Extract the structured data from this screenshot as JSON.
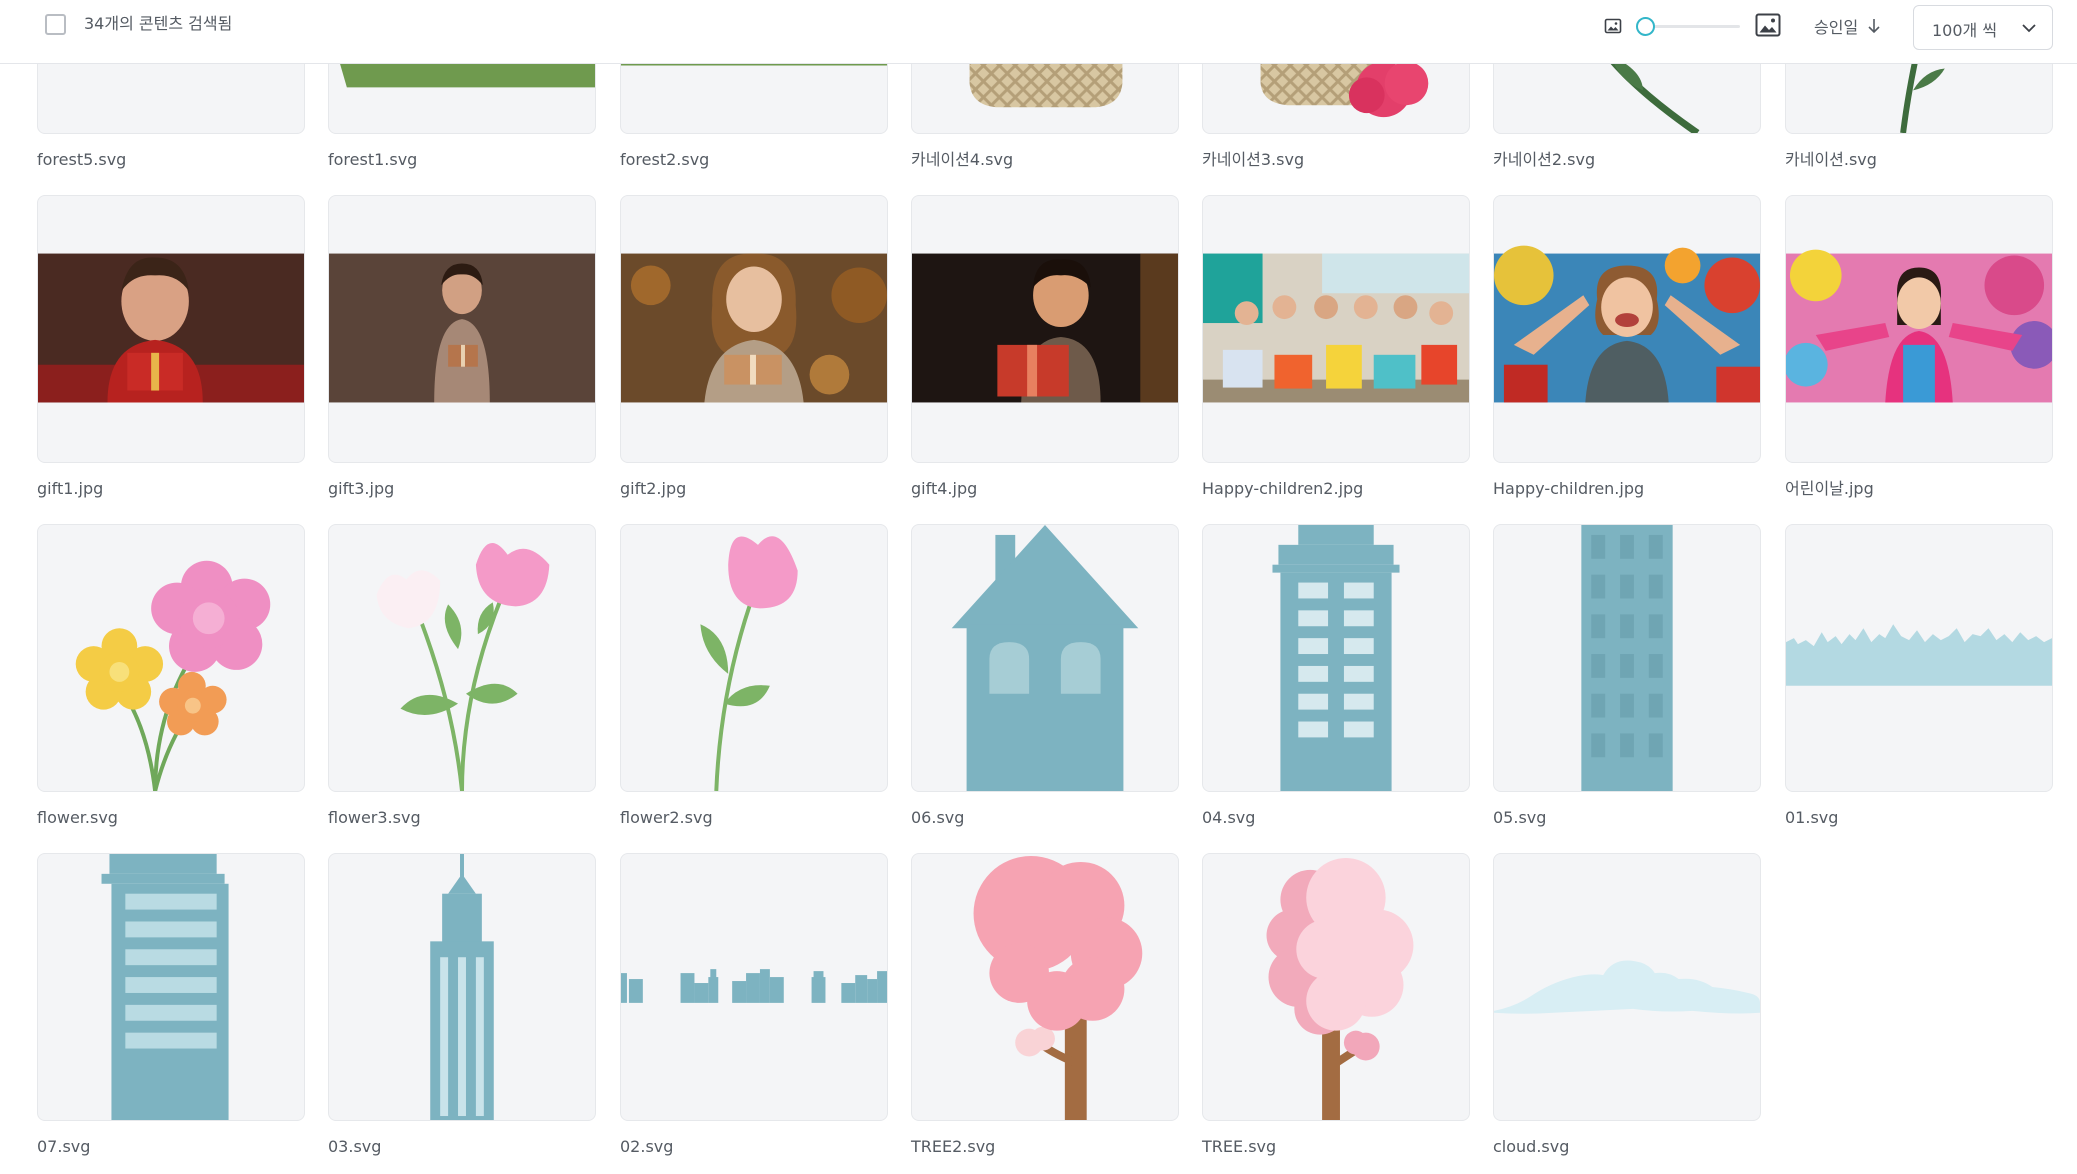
{
  "toolbar": {
    "result_count": "34개의 콘텐츠 검색됨",
    "sort_label": "승인일",
    "page_size": "100개 씩",
    "slider_value": 0,
    "accent": "#33b6c9"
  },
  "items": [
    {
      "name": "forest5.svg"
    },
    {
      "name": "forest1.svg"
    },
    {
      "name": "forest2.svg"
    },
    {
      "name": "카네이션4.svg"
    },
    {
      "name": "카네이션3.svg"
    },
    {
      "name": "카네이션2.svg"
    },
    {
      "name": "카네이션.svg"
    },
    {
      "name": "gift1.jpg"
    },
    {
      "name": "gift3.jpg"
    },
    {
      "name": "gift2.jpg"
    },
    {
      "name": "gift4.jpg"
    },
    {
      "name": "Happy-children2.jpg"
    },
    {
      "name": "Happy-children.jpg"
    },
    {
      "name": "어린이날.jpg"
    },
    {
      "name": "flower.svg"
    },
    {
      "name": "flower3.svg"
    },
    {
      "name": "flower2.svg"
    },
    {
      "name": "06.svg"
    },
    {
      "name": "04.svg"
    },
    {
      "name": "05.svg"
    },
    {
      "name": "01.svg"
    },
    {
      "name": "07.svg"
    },
    {
      "name": "03.svg"
    },
    {
      "name": "02.svg"
    },
    {
      "name": "TREE2.svg"
    },
    {
      "name": "TREE.svg"
    },
    {
      "name": "cloud.svg"
    }
  ]
}
